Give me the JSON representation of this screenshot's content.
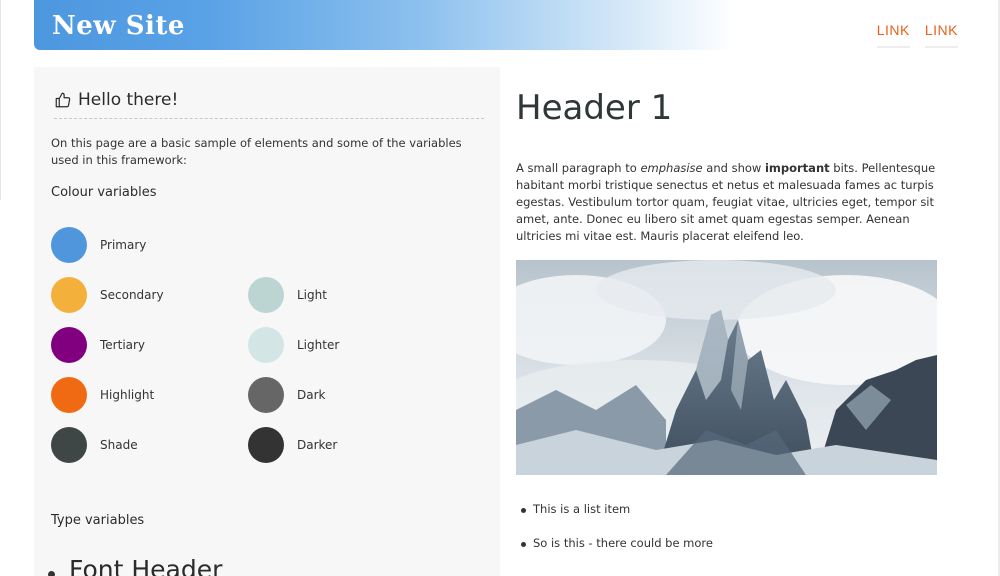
{
  "header": {
    "site_title": "New Site",
    "nav": [
      {
        "label": "LINK"
      },
      {
        "label": "LINK"
      }
    ]
  },
  "panel": {
    "heading": "Hello there!",
    "intro": "On this page are a basic sample of elements and some of the variables used in this framework:",
    "colour_title": "Colour variables",
    "colours_left": [
      {
        "label": "Primary",
        "color": "#4f96dd"
      },
      {
        "label": "Secondary",
        "color": "#f3b13b"
      },
      {
        "label": "Tertiary",
        "color": "#800080"
      },
      {
        "label": "Highlight",
        "color": "#ef6a12"
      },
      {
        "label": "Shade",
        "color": "#3e4646"
      }
    ],
    "colours_right": [
      {
        "label": "Light",
        "color": "#bcd4d2"
      },
      {
        "label": "Lighter",
        "color": "#d4e5e5"
      },
      {
        "label": "Dark",
        "color": "#666666"
      },
      {
        "label": "Darker",
        "color": "#333333"
      }
    ],
    "type_title": "Type variables",
    "font_header_item": "Font Header"
  },
  "main": {
    "h1": "Header 1",
    "para": {
      "p1": "A small paragraph to ",
      "em": "emphasise",
      "p2": " and show ",
      "strong": "important",
      "p3": " bits. Pellentesque habitant morbi tristique senectus et netus et malesuada fames ac turpis egestas. Vestibulum tortor quam, feugiat vitae, ultricies eget, tempor sit amet, ante. Donec eu libero sit amet quam egestas semper. Aenean ultricies mi vitae est. Mauris placerat eleifend leo."
    },
    "list": [
      {
        "text": "This is a list item"
      },
      {
        "text": "So is this - there could be more"
      }
    ]
  },
  "icons": {
    "heading_icon": "thumbs-up-icon"
  }
}
